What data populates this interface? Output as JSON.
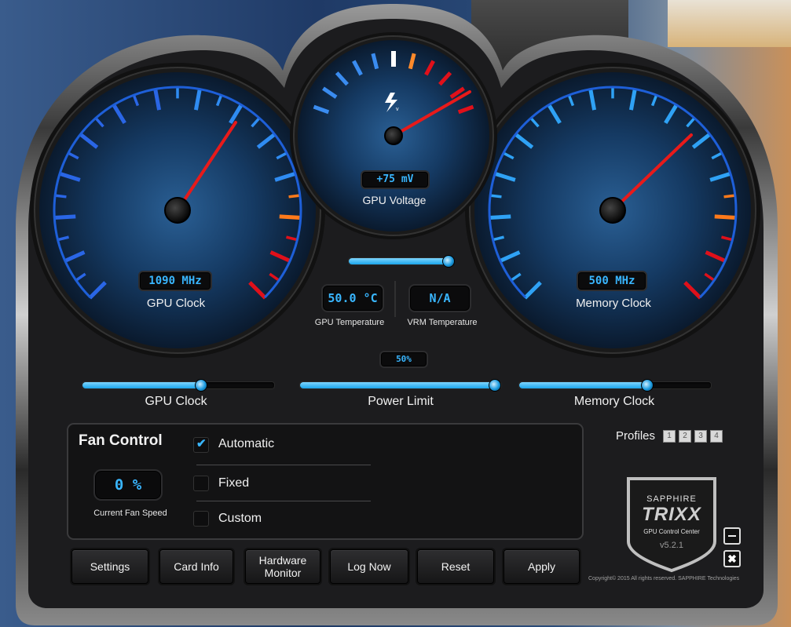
{
  "gauges": {
    "gpu_clock": {
      "readout": "1090 MHz",
      "label": "GPU Clock"
    },
    "gpu_voltage": {
      "readout": "+75 mV",
      "label": "GPU Voltage"
    },
    "memory_clock": {
      "readout": "500 MHz",
      "label": "Memory Clock"
    }
  },
  "temperatures": {
    "gpu": {
      "value": "50.0 °C",
      "label": "GPU Temperature"
    },
    "vrm": {
      "value": "N/A",
      "label": "VRM Temperature"
    }
  },
  "sliders": {
    "voltage": {
      "level": 0.98
    },
    "power_limit": {
      "readout": "50%",
      "label": "Power Limit",
      "level": 0.97
    },
    "gpu_clock": {
      "label": "GPU Clock",
      "level": 0.62
    },
    "memory_clock": {
      "label": "Memory Clock",
      "level": 0.67
    }
  },
  "fan_control": {
    "title": "Fan Control",
    "speed": "0 %",
    "speed_label": "Current Fan Speed",
    "options": [
      {
        "label": "Automatic",
        "checked": true
      },
      {
        "label": "Fixed",
        "checked": false
      },
      {
        "label": "Custom",
        "checked": false
      }
    ]
  },
  "profiles": {
    "label": "Profiles",
    "items": [
      "1",
      "2",
      "3",
      "4"
    ]
  },
  "buttons": {
    "settings": "Settings",
    "card_info": "Card Info",
    "hardware_monitor_1": "Hardware",
    "hardware_monitor_2": "Monitor",
    "log_now": "Log Now",
    "reset": "Reset",
    "apply": "Apply"
  },
  "logo": {
    "brand": "SAPPHIRE",
    "product": "TRIXX",
    "subtitle": "GPU Control Center",
    "version": "v5.2.1"
  },
  "window_controls": {
    "minimize_icon": "minimize-icon",
    "close_icon": "close-icon"
  },
  "copyright": "Copyright© 2015 All rights reserved. SAPPHIRE Technologies",
  "colors": {
    "accent": "#39b6ff",
    "warning": "#ff7a1a",
    "danger": "#e0101a",
    "needle": "#e81a1a"
  }
}
